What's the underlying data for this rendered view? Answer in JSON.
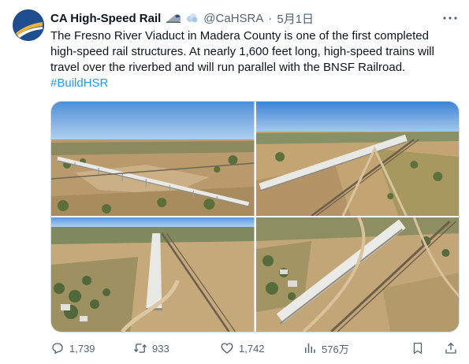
{
  "tweet": {
    "author": {
      "name": "CA High-Speed Rail",
      "handle": "@CaHSRA",
      "separator": "·",
      "date": "5月1日"
    },
    "text": {
      "body": "The Fresno River Viaduct in Madera County is one of the first completed high-speed rail structures. At nearly 1,600 feet long, high-speed trains will travel over the riverbed and will run parallel with the BNSF Railroad.",
      "hashtag": "#BuildHSR"
    },
    "media": [
      {
        "icon": "aerial-photo-viaduct-long-view"
      },
      {
        "icon": "aerial-photo-viaduct-diagonal"
      },
      {
        "icon": "aerial-photo-viaduct-overhead"
      },
      {
        "icon": "aerial-photo-viaduct-closeup"
      }
    ],
    "stats": {
      "replies": "1,739",
      "reposts": "933",
      "likes": "1,742",
      "views": "576万"
    }
  },
  "colors": {
    "text": "#0f1419",
    "secondary": "#536471",
    "link": "#1d9bf0",
    "border": "#cfd9de"
  }
}
